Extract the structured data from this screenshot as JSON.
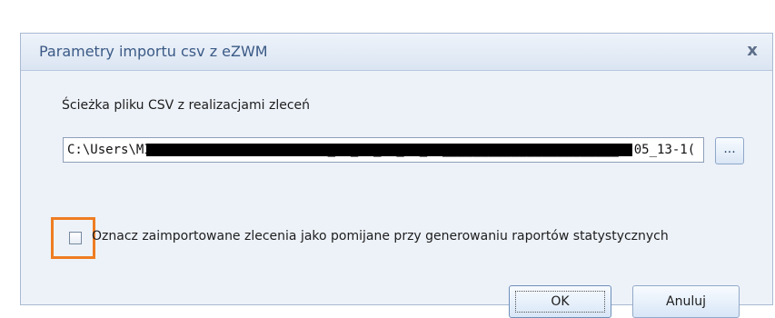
{
  "dialog": {
    "title": "Parametry importu csv z eZWM",
    "close_label": "x",
    "path_label": "Ścieżka pliku CSV z realizacjami zleceń",
    "path_value": "C:\\Users\\MICHALINA7\\Downloads\\2023_04_24_13_20_00_______________________7-05_13-1(",
    "browse_label": "...",
    "checkbox_label": "Oznacz zaimportowane zlecenia jako pomijane przy generowaniu raportów statystycznych",
    "checkbox_checked": false,
    "ok_label": "OK",
    "cancel_label": "Anuluj"
  },
  "colors": {
    "title": "#3b5a86",
    "highlight": "#ef7d22",
    "panel": "#edf2f9"
  }
}
